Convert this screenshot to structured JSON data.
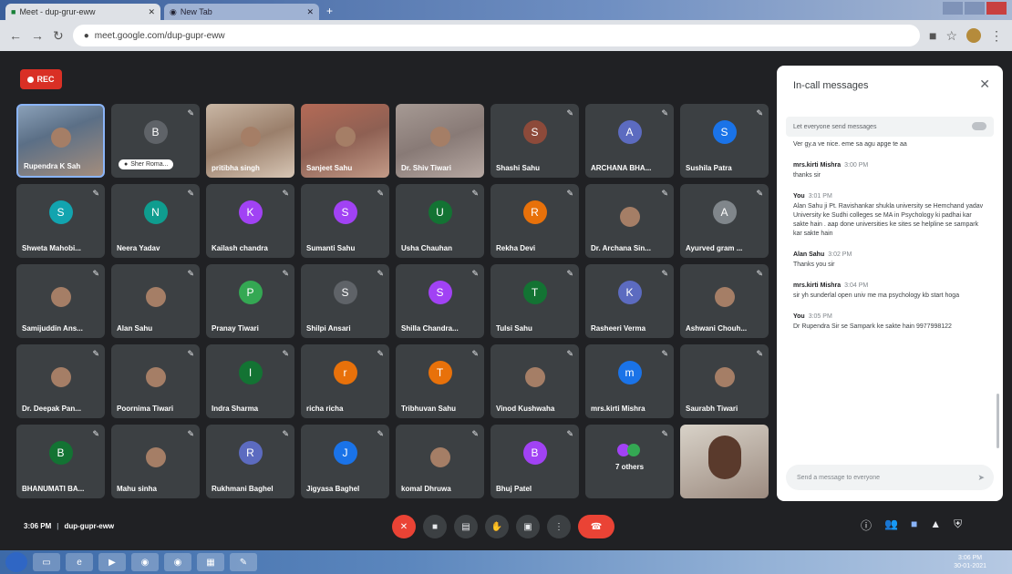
{
  "browser": {
    "tabs": [
      {
        "title": "Meet - dup-grur-eww"
      },
      {
        "title": "New Tab"
      }
    ],
    "url": "meet.google.com/dup-gupr-eww"
  },
  "meet": {
    "rec_label": "REC",
    "participants": [
      {
        "name": "Rupendra K Sah",
        "type": "video",
        "style": "v1"
      },
      {
        "name": "Sher Roma",
        "type": "avatar",
        "letter": "B",
        "color": "#5f6368",
        "tag": "Sher Roma..."
      },
      {
        "name": "pritibha singh",
        "type": "video",
        "style": "v2"
      },
      {
        "name": "Sanjeet Sahu",
        "type": "video",
        "style": "v3"
      },
      {
        "name": "Dr. Shiv Tiwari",
        "type": "video",
        "style": "v4"
      },
      {
        "name": "Shashi Sahu",
        "type": "avatar",
        "letter": "S",
        "color": "#8d4a3a"
      },
      {
        "name": "ARCHANA BHA...",
        "type": "avatar",
        "letter": "A",
        "color": "#5c6bc0"
      },
      {
        "name": "Sushila Patra",
        "type": "avatar",
        "letter": "S",
        "color": "#1a73e8"
      },
      {
        "name": "Shweta Mahobi...",
        "type": "avatar",
        "letter": "S",
        "color": "#12a4af"
      },
      {
        "name": "Neera Yadav",
        "type": "avatar",
        "letter": "N",
        "color": "#0f9d8f"
      },
      {
        "name": "Kailash chandra",
        "type": "avatar",
        "letter": "K",
        "color": "#a142f4"
      },
      {
        "name": "Sumanti Sahu",
        "type": "avatar",
        "letter": "S",
        "color": "#a142f4"
      },
      {
        "name": "Usha Chauhan",
        "type": "avatar",
        "letter": "U",
        "color": "#137333"
      },
      {
        "name": "Rekha Devi",
        "type": "avatar",
        "letter": "R",
        "color": "#e8710a"
      },
      {
        "name": "Dr. Archana Sin...",
        "type": "photo"
      },
      {
        "name": "Ayurved gram ...",
        "type": "avatar",
        "letter": "A",
        "color": "#80868b"
      },
      {
        "name": "Samijuddin Ans...",
        "type": "photo"
      },
      {
        "name": "Alan Sahu",
        "type": "photo"
      },
      {
        "name": "Pranay Tiwari",
        "type": "avatar",
        "letter": "P",
        "color": "#34a853"
      },
      {
        "name": "Shilpi Ansari",
        "type": "avatar",
        "letter": "S",
        "color": "#5f6368"
      },
      {
        "name": "Shilla Chandra...",
        "type": "avatar",
        "letter": "S",
        "color": "#a142f4"
      },
      {
        "name": "Tulsi Sahu",
        "type": "avatar",
        "letter": "T",
        "color": "#137333"
      },
      {
        "name": "Rasheeri Verma",
        "type": "avatar",
        "letter": "K",
        "color": "#5c6bc0"
      },
      {
        "name": "Ashwani Chouh...",
        "type": "photo"
      },
      {
        "name": "Dr. Deepak Pan...",
        "type": "photo"
      },
      {
        "name": "Poornima Tiwari",
        "type": "photo"
      },
      {
        "name": "Indra Sharma",
        "type": "avatar",
        "letter": "I",
        "color": "#137333"
      },
      {
        "name": "richa richa",
        "type": "avatar",
        "letter": "r",
        "color": "#e8710a"
      },
      {
        "name": "Tribhuvan Sahu",
        "type": "avatar",
        "letter": "T",
        "color": "#e8710a"
      },
      {
        "name": "Vinod Kushwaha",
        "type": "photo"
      },
      {
        "name": "mrs.kirti Mishra",
        "type": "avatar",
        "letter": "m",
        "color": "#1a73e8"
      },
      {
        "name": "Saurabh Tiwari",
        "type": "photo"
      },
      {
        "name": "BHANUMATI BA...",
        "type": "avatar",
        "letter": "B",
        "color": "#137333"
      },
      {
        "name": "Mahu sinha",
        "type": "photo"
      },
      {
        "name": "Rukhmani Baghel",
        "type": "avatar",
        "letter": "R",
        "color": "#5c6bc0"
      },
      {
        "name": "Jigyasa Baghel",
        "type": "avatar",
        "letter": "J",
        "color": "#1a73e8"
      },
      {
        "name": "komal Dhruwa",
        "type": "photo"
      },
      {
        "name": "Bhuj Patel",
        "type": "avatar",
        "letter": "B",
        "color": "#a142f4"
      },
      {
        "name": "7 others",
        "type": "others"
      },
      {
        "name": "",
        "type": "self"
      }
    ],
    "time": "3:06 PM",
    "meeting_code": "dup-gupr-eww"
  },
  "chat": {
    "title": "In-call messages",
    "toggle_label": "Let everyone send messages",
    "messages": [
      {
        "sender": "",
        "time": "",
        "text": "Ver gy.a ve nice. eme sa agu apge te aa"
      },
      {
        "sender": "mrs.kirti Mishra",
        "time": "3:00 PM",
        "text": "thanks sir"
      },
      {
        "sender": "You",
        "time": "3:01 PM",
        "text": "Alan Sahu ji Pt. Ravishankar shukla university se Hemchand yadav University ke Sudhi colleges se MA in Psychology ki padhai kar sakte hain . aap done universities ke sites se helpline se sampark kar sakte hain"
      },
      {
        "sender": "Alan Sahu",
        "time": "3:02 PM",
        "text": "Thanks you sir"
      },
      {
        "sender": "mrs.kirti Mishra",
        "time": "3:04 PM",
        "text": "sir yh sunderlal open univ me ma psychology kb start hoga"
      },
      {
        "sender": "You",
        "time": "3:05 PM",
        "text": "Dr Rupendra Sir se Sampark ke sakte hain 9977998122"
      }
    ],
    "compose_placeholder": "Send a message to everyone"
  },
  "taskbar": {
    "clock_time": "3:06 PM",
    "clock_date": "30-01-2021"
  }
}
